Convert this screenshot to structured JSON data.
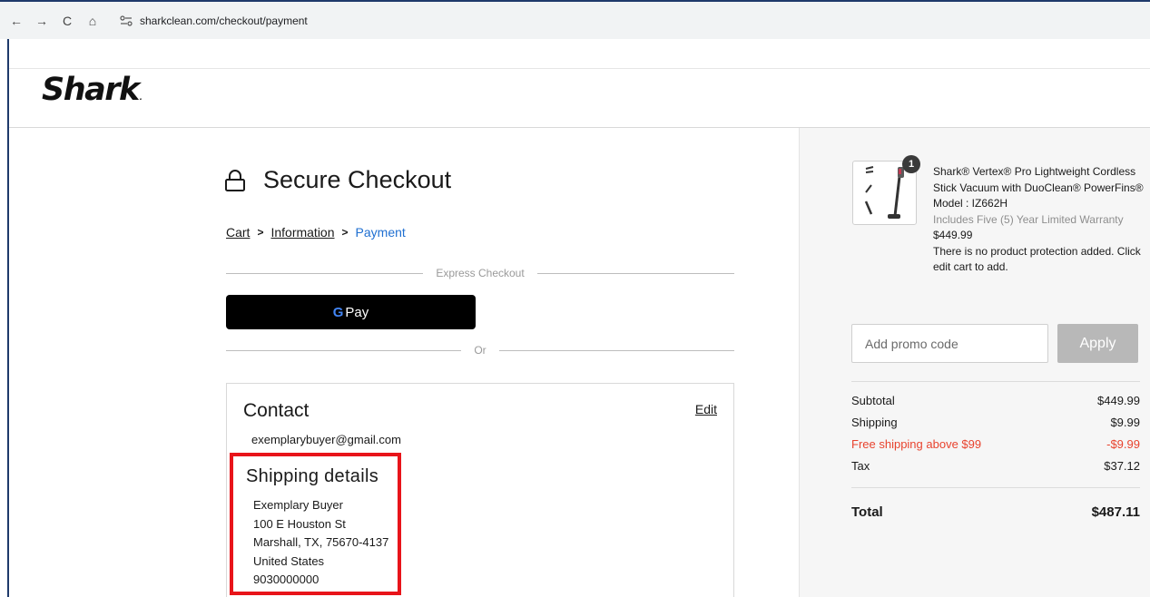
{
  "browser": {
    "back_glyph": "←",
    "forward_glyph": "→",
    "reload_glyph": "C",
    "home_glyph": "⌂",
    "url": "sharkclean.com/checkout/payment"
  },
  "header": {
    "logo_text": "Shark",
    "logo_dot": "."
  },
  "checkout": {
    "title": "Secure Checkout",
    "breadcrumb": {
      "cart": "Cart",
      "information": "Information",
      "payment": "Payment",
      "separator": ">"
    },
    "express_label": "Express Checkout",
    "gpay_g": "G",
    "gpay_text": "Pay",
    "or_label": "Or"
  },
  "contact": {
    "title": "Contact",
    "edit_label": "Edit",
    "email": "exemplarybuyer@gmail.com"
  },
  "shipping": {
    "title": "Shipping details",
    "name": "Exemplary Buyer",
    "street": "100 E Houston St",
    "city_line": "Marshall, TX, 75670-4137",
    "country": "United States",
    "phone": "9030000000"
  },
  "order": {
    "quantity": "1",
    "product_name": "Shark® Vertex® Pro Lightweight Cordless Stick Vacuum with DuoClean® PowerFins®",
    "model": "Model : IZ662H",
    "warranty": "Includes Five (5) Year Limited Warranty",
    "price": "$449.99",
    "protection_note": "There is no product protection added. Click edit cart to add.",
    "promo_placeholder": "Add promo code",
    "apply_label": "Apply"
  },
  "summary": {
    "subtotal_label": "Subtotal",
    "subtotal_value": "$449.99",
    "shipping_label": "Shipping",
    "shipping_value": "$9.99",
    "free_shipping_label": "Free shipping above $99",
    "free_shipping_value": "-$9.99",
    "tax_label": "Tax",
    "tax_value": "$37.12",
    "total_label": "Total",
    "total_value": "$487.11"
  },
  "colors": {
    "highlight_border": "#e8141a",
    "breadcrumb_active": "#1f6fd1",
    "discount_red": "#e8432e",
    "apply_button": "#b8b8b8"
  }
}
